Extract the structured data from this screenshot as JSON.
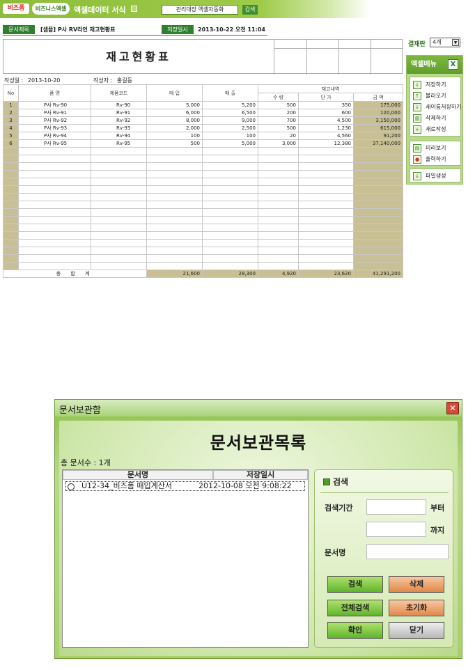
{
  "topbar": {
    "logo1": "비즈폼",
    "logo2": "비즈니스엑셀",
    "app_title": "엑셀데이터 서식",
    "select_value": "관리대장 엑셀자동화",
    "search_btn": "검색"
  },
  "docinfo": {
    "title_label": "문서제목",
    "title_value": "[샘플] P사 RV라인 재고현황표",
    "saved_label": "저장일시",
    "saved_value": "2013-10-22  오전 11:04"
  },
  "sheet": {
    "title": "재고현황표",
    "date_label": "작성일 :",
    "date_value": "2013-10-20",
    "author_label": "작성자 :",
    "author_value": "홍길동",
    "headers": {
      "no": "No",
      "name": "품 명",
      "code": "제품코드",
      "buy": "매 입",
      "sell": "매 출",
      "stock": "재고내역",
      "qty": "수 량",
      "price": "단 가",
      "amount": "금 액"
    },
    "rows": [
      {
        "no": "1",
        "name": "P사 Rv-90",
        "code": "Rv-90",
        "buy": "5,000",
        "sell": "5,200",
        "qty": "500",
        "price": "350",
        "amount": "175,000"
      },
      {
        "no": "2",
        "name": "P사 Rv-91",
        "code": "Rv-91",
        "buy": "6,000",
        "sell": "6,500",
        "qty": "200",
        "price": "600",
        "amount": "120,000"
      },
      {
        "no": "3",
        "name": "P사 Rv-92",
        "code": "Rv-92",
        "buy": "8,000",
        "sell": "9,000",
        "qty": "700",
        "price": "4,500",
        "amount": "3,150,000"
      },
      {
        "no": "4",
        "name": "P사 Rv-93",
        "code": "Rv-93",
        "buy": "2,000",
        "sell": "2,500",
        "qty": "500",
        "price": "1,230",
        "amount": "615,000"
      },
      {
        "no": "5",
        "name": "P사 Rv-94",
        "code": "Rv-94",
        "buy": "100",
        "sell": "100",
        "qty": "20",
        "price": "4,560",
        "amount": "91,200"
      },
      {
        "no": "6",
        "name": "P사 Rv-95",
        "code": "Rv-95",
        "buy": "500",
        "sell": "5,000",
        "qty": "3,000",
        "price": "12,380",
        "amount": "37,140,000"
      }
    ],
    "total": {
      "label": "총 합 계",
      "buy": "21,600",
      "sell": "28,300",
      "qty": "4,920",
      "price": "23,620",
      "amount": "41,291,200"
    }
  },
  "rightpanel": {
    "approval_label": "결재란",
    "approval_value": "4개",
    "menu_title": "엑셀메뉴",
    "menu_items": [
      "저장하기",
      "불러오기",
      "새이름저장하기",
      "삭제하기",
      "새로작성",
      "미리보기",
      "출력하기",
      "파일생성"
    ]
  },
  "dialog": {
    "title": "문서보관함",
    "heading": "문서보관목록",
    "count": "총 문서수 : 1개",
    "col_name": "문서명",
    "col_date": "저장일시",
    "item_name": "U12-34_비즈폼 매입계산서",
    "item_date": "2012-10-08 오전 9:08:22",
    "search_title": "검색",
    "period_label": "검색기간",
    "from_label": "부터",
    "to_label": "까지",
    "docname_label": "문서명",
    "btn_search": "검색",
    "btn_delete": "삭제",
    "btn_search_all": "전체검색",
    "btn_reset": "초기화",
    "btn_ok": "확인",
    "btn_close": "닫기"
  }
}
